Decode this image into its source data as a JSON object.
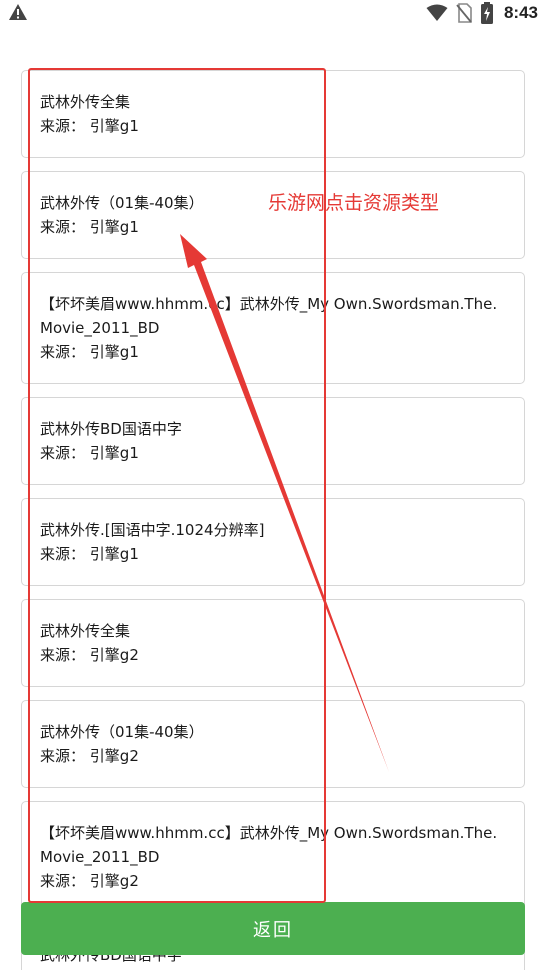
{
  "status_bar": {
    "time": "8:43",
    "icons": [
      "warning-icon",
      "wifi-icon",
      "no-sim-icon",
      "battery-icon"
    ]
  },
  "list": {
    "source_prefix": "来源：",
    "items": [
      {
        "title": "武林外传全集",
        "engine": "引擎g1"
      },
      {
        "title": "武林外传（01集-40集）",
        "engine": "引擎g1"
      },
      {
        "title": "【坏坏美眉www.hhmm.cc】武林外传_My Own.Swordsman.The.Movie_2011_BD",
        "engine": "引擎g1"
      },
      {
        "title": "武林外传BD国语中字",
        "engine": "引擎g1"
      },
      {
        "title": "武林外传.[国语中字.1024分辨率]",
        "engine": "引擎g1"
      },
      {
        "title": "武林外传全集",
        "engine": "引擎g2"
      },
      {
        "title": "武林外传（01集-40集）",
        "engine": "引擎g2"
      },
      {
        "title": "【坏坏美眉www.hhmm.cc】武林外传_My Own.Swordsman.The.Movie_2011_BD",
        "engine": "引擎g2"
      },
      {
        "title": "武林外传BD国语中字",
        "engine": ""
      }
    ]
  },
  "back_button": {
    "label": "返回"
  },
  "annotation": {
    "text": "乐游网点击资源类型",
    "color": "#e53935"
  },
  "colors": {
    "accent": "#4caf50",
    "annotation": "#e53935",
    "card_border": "#d6d6d6"
  }
}
